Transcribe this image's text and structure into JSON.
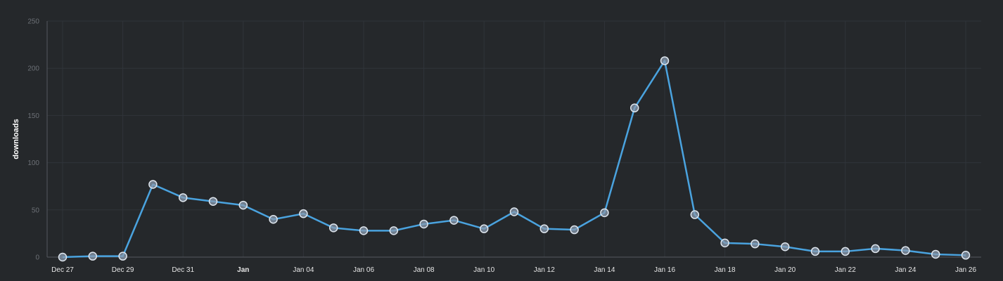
{
  "chart_data": {
    "type": "line",
    "ylabel": "downloads",
    "xlabel": "",
    "ylim": [
      0,
      250
    ],
    "y_ticks": [
      0,
      50,
      100,
      150,
      200,
      250
    ],
    "x_tick_labels": [
      {
        "date": "Dec 27",
        "label": "Dec 27",
        "bold": false
      },
      {
        "date": "Dec 29",
        "label": "Dec 29",
        "bold": false
      },
      {
        "date": "Dec 31",
        "label": "Dec 31",
        "bold": false
      },
      {
        "date": "Jan 02",
        "label": "Jan",
        "bold": true
      },
      {
        "date": "Jan 04",
        "label": "Jan 04",
        "bold": false
      },
      {
        "date": "Jan 06",
        "label": "Jan 06",
        "bold": false
      },
      {
        "date": "Jan 08",
        "label": "Jan 08",
        "bold": false
      },
      {
        "date": "Jan 10",
        "label": "Jan 10",
        "bold": false
      },
      {
        "date": "Jan 12",
        "label": "Jan 12",
        "bold": false
      },
      {
        "date": "Jan 14",
        "label": "Jan 14",
        "bold": false
      },
      {
        "date": "Jan 16",
        "label": "Jan 16",
        "bold": false
      },
      {
        "date": "Jan 18",
        "label": "Jan 18",
        "bold": false
      },
      {
        "date": "Jan 20",
        "label": "Jan 20",
        "bold": false
      },
      {
        "date": "Jan 22",
        "label": "Jan 22",
        "bold": false
      },
      {
        "date": "Jan 24",
        "label": "Jan 24",
        "bold": false
      },
      {
        "date": "Jan 26",
        "label": "Jan 26",
        "bold": false
      }
    ],
    "grid": true,
    "legend": "none",
    "series": [
      {
        "color": "#4aa3df",
        "x": [
          "Dec 27",
          "Dec 28",
          "Dec 29",
          "Dec 30",
          "Dec 31",
          "Jan 01",
          "Jan 02",
          "Jan 03",
          "Jan 04",
          "Jan 05",
          "Jan 06",
          "Jan 07",
          "Jan 08",
          "Jan 09",
          "Jan 10",
          "Jan 11",
          "Jan 12",
          "Jan 13",
          "Jan 14",
          "Jan 15",
          "Jan 16",
          "Jan 17",
          "Jan 18",
          "Jan 19",
          "Jan 20",
          "Jan 21",
          "Jan 22",
          "Jan 23",
          "Jan 24",
          "Jan 25",
          "Jan 26"
        ],
        "values": [
          0,
          1,
          1,
          77,
          63,
          59,
          55,
          40,
          46,
          31,
          28,
          28,
          35,
          39,
          30,
          48,
          30,
          29,
          47,
          158,
          208,
          45,
          15,
          14,
          11,
          6,
          6,
          9,
          7,
          3,
          2
        ]
      }
    ]
  }
}
